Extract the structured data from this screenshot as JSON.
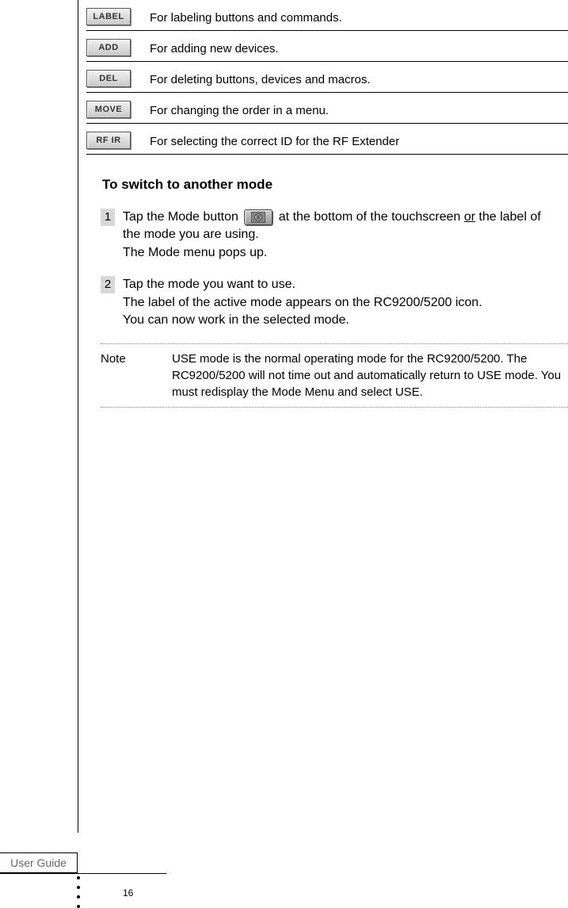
{
  "modes": [
    {
      "label": "LABEL",
      "desc": "For labeling buttons and commands."
    },
    {
      "label": "ADD",
      "desc": "For adding new devices."
    },
    {
      "label": "DEL",
      "desc": "For deleting buttons, devices and macros."
    },
    {
      "label": "MOVE",
      "desc": "For changing the order in a menu."
    },
    {
      "label": "RF  IR",
      "desc": "For selecting the correct ID for the RF Extender"
    }
  ],
  "section_title": "To switch to another mode",
  "steps": {
    "s1": {
      "num": "1",
      "pre": "Tap the Mode button ",
      "post_a": " at the bottom of the touchscreen ",
      "or": "or",
      "post_b": " the label of the mode you are using.",
      "line2": "The Mode menu pops up."
    },
    "s2": {
      "num": "2",
      "line1": "Tap the mode you want to use.",
      "line2": "The label of the active mode appears on the RC9200/5200 icon.",
      "line3": "You can now work in the selected mode."
    }
  },
  "note": {
    "label": "Note",
    "text": "USE mode is the normal operating mode for the RC9200/5200. The RC9200/5200 will not  time out  and automa­tically return to USE mode. You must redisplay the Mode Menu and select USE."
  },
  "footer": {
    "tab": "User Guide",
    "page": "16"
  }
}
